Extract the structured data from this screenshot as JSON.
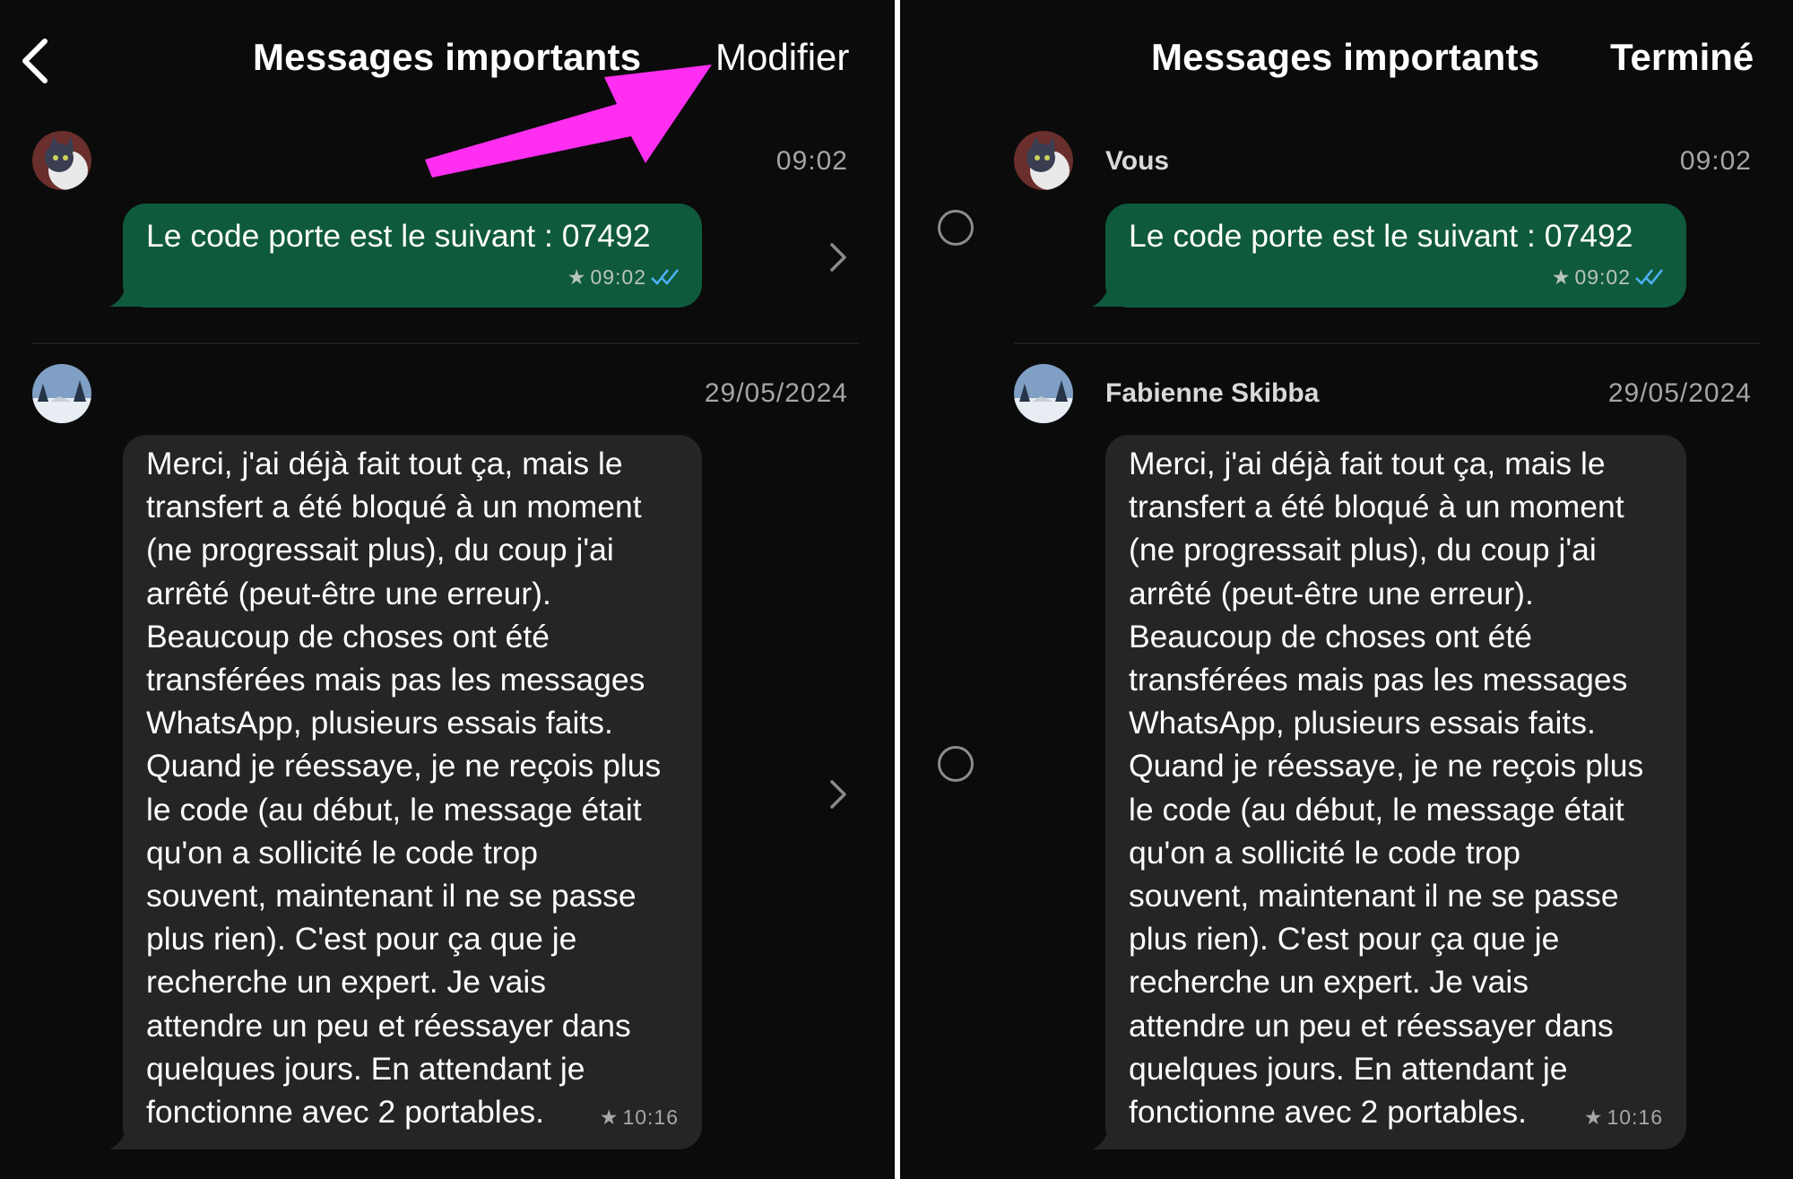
{
  "left_panel": {
    "header": {
      "title": "Messages importants",
      "action": "Modifier"
    },
    "messages": [
      {
        "time": "09:02",
        "text_lines": [
          "Le code porte est le suivant : 07492"
        ],
        "meta_time": "09:02"
      },
      {
        "time": "29/05/2024",
        "text_lines": [
          "Merci, j'ai déjà fait tout ça, mais le",
          "transfert a été bloqué à un moment",
          "(ne progressait plus), du coup j'ai",
          "arrêté (peut-être une erreur).",
          "Beaucoup de choses ont été",
          "transférées mais pas les messages",
          "WhatsApp, plusieurs essais faits.",
          "Quand je réessaye, je ne reçois plus",
          "le code (au début, le message était",
          "qu'on a sollicité le code trop",
          "souvent, maintenant il ne se passe",
          "plus rien). C'est pour ça que je",
          "recherche un expert. Je vais",
          "attendre un peu et réessayer dans",
          "quelques jours. En attendant je",
          "fonctionne avec 2 portables."
        ],
        "meta_time": "10:16"
      }
    ]
  },
  "right_panel": {
    "header": {
      "title": "Messages importants",
      "action": "Terminé"
    },
    "messages": [
      {
        "sender": "Vous",
        "time": "09:02",
        "text_lines": [
          "Le code porte est le suivant : 07492"
        ],
        "meta_time": "09:02"
      },
      {
        "sender": "Fabienne Skibba",
        "time": "29/05/2024",
        "text_lines": [
          "Merci, j'ai déjà fait tout ça, mais le",
          "transfert a été bloqué à un moment",
          "(ne progressait plus), du coup j'ai",
          "arrêté (peut-être une erreur).",
          "Beaucoup de choses ont été",
          "transférées mais pas les messages",
          "WhatsApp, plusieurs essais faits.",
          "Quand je réessaye, je ne reçois plus",
          "le code (au début, le message était",
          "qu'on a sollicité le code trop",
          "souvent, maintenant il ne se passe",
          "plus rien). C'est pour ça que je",
          "recherche un expert. Je vais",
          "attendre un peu et réessayer dans",
          "quelques jours. En attendant je",
          "fonctionne avec 2 portables."
        ],
        "meta_time": "10:16"
      }
    ]
  },
  "icons": {
    "back": "chevron-left-icon",
    "star": "star-icon",
    "read": "double-check-icon",
    "disclosure": "chevron-right-icon",
    "select": "selection-circle-icon",
    "annotation": "arrow-annotation-icon"
  },
  "colors": {
    "background": "#0b0b0b",
    "outgoing_bubble": "#0f5a3c",
    "incoming_bubble": "#252525",
    "read_ticks": "#4fb3f6",
    "annotation_arrow": "#ff2ef0"
  }
}
